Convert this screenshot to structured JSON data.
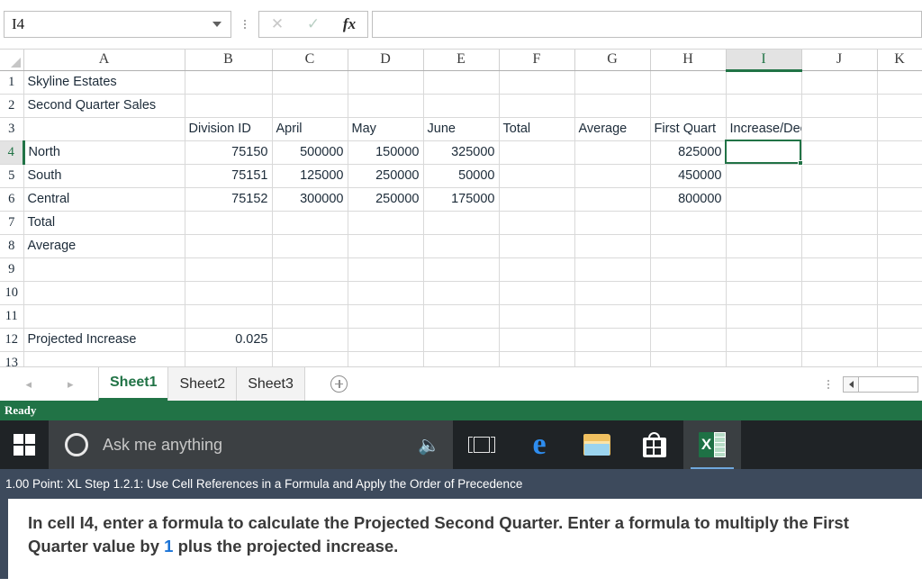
{
  "formula_bar": {
    "name_box_value": "I4",
    "name_box_placeholder": "Name Box",
    "formula_value": "",
    "formula_placeholder": "",
    "cancel_icon": "close-icon",
    "enter_icon": "check-icon",
    "fx_label": "fx"
  },
  "grid": {
    "columns": [
      "A",
      "B",
      "C",
      "D",
      "E",
      "F",
      "G",
      "H",
      "I",
      "J",
      "K"
    ],
    "selected_cell": "I4",
    "selected_column": "I",
    "selected_row": "4",
    "rows": [
      {
        "num": "1",
        "cells": [
          "Skyline Estates",
          "",
          "",
          "",
          "",
          "",
          "",
          "",
          "",
          "",
          ""
        ]
      },
      {
        "num": "2",
        "cells": [
          "Second Quarter Sales",
          "",
          "",
          "",
          "",
          "",
          "",
          "",
          "",
          "",
          ""
        ]
      },
      {
        "num": "3",
        "cells": [
          "",
          "Division ID",
          "April",
          "May",
          "June",
          "Total",
          "Average",
          "First Quart",
          "Increase/Decrease",
          "",
          ""
        ]
      },
      {
        "num": "4",
        "cells": [
          "North",
          "75150",
          "500000",
          "150000",
          "325000",
          "",
          "",
          "825000",
          "",
          "",
          ""
        ]
      },
      {
        "num": "5",
        "cells": [
          "South",
          "75151",
          "125000",
          "250000",
          "50000",
          "",
          "",
          "450000",
          "",
          "",
          ""
        ]
      },
      {
        "num": "6",
        "cells": [
          "Central",
          "75152",
          "300000",
          "250000",
          "175000",
          "",
          "",
          "800000",
          "",
          "",
          ""
        ]
      },
      {
        "num": "7",
        "cells": [
          "Total",
          "",
          "",
          "",
          "",
          "",
          "",
          "",
          "",
          "",
          ""
        ]
      },
      {
        "num": "8",
        "cells": [
          "Average",
          "",
          "",
          "",
          "",
          "",
          "",
          "",
          "",
          "",
          ""
        ]
      },
      {
        "num": "9",
        "cells": [
          "",
          "",
          "",
          "",
          "",
          "",
          "",
          "",
          "",
          "",
          ""
        ]
      },
      {
        "num": "10",
        "cells": [
          "",
          "",
          "",
          "",
          "",
          "",
          "",
          "",
          "",
          "",
          ""
        ]
      },
      {
        "num": "11",
        "cells": [
          "",
          "",
          "",
          "",
          "",
          "",
          "",
          "",
          "",
          "",
          ""
        ]
      },
      {
        "num": "12",
        "cells": [
          "Projected Increase",
          "0.025",
          "",
          "",
          "",
          "",
          "",
          "",
          "",
          "",
          ""
        ]
      },
      {
        "num": "13",
        "cells": [
          "",
          "",
          "",
          "",
          "",
          "",
          "",
          "",
          "",
          "",
          ""
        ]
      }
    ]
  },
  "sheet_tabs": {
    "prev_arrow": "◂",
    "next_arrow": "▸",
    "tabs": [
      {
        "label": "Sheet1",
        "active": true
      },
      {
        "label": "Sheet2",
        "active": false
      },
      {
        "label": "Sheet3",
        "active": false
      }
    ],
    "add_sheet_icon": "plus-circle-icon"
  },
  "status_bar": {
    "text": "Ready"
  },
  "taskbar": {
    "start_icon": "windows-logo-icon",
    "search_placeholder": "Ask me anything",
    "mic_icon": "microphone-icon",
    "items": [
      {
        "name": "task-view",
        "label": "Task View",
        "active": false
      },
      {
        "name": "edge",
        "label": "Microsoft Edge",
        "active": false
      },
      {
        "name": "file-explorer",
        "label": "File Explorer",
        "active": false
      },
      {
        "name": "store",
        "label": "Microsoft Store",
        "active": false
      },
      {
        "name": "excel",
        "label": "Excel",
        "active": true
      }
    ],
    "excel_letter": "X"
  },
  "task_panel": {
    "header": "1.00 Point: XL Step 1.2.1: Use Cell References in a Formula and Apply the Order of Precedence",
    "instruction_part1": "In cell I4, enter a formula to calculate the Projected Second Quarter. Enter a formula to multiply the First Quarter value by ",
    "instruction_highlight": "1",
    "instruction_part2": " plus the projected increase."
  },
  "colors": {
    "excel_green": "#217346",
    "panel_navy": "#3d4a5c",
    "highlight_blue": "#1a73d6",
    "taskbar_dark": "#1f2326"
  }
}
